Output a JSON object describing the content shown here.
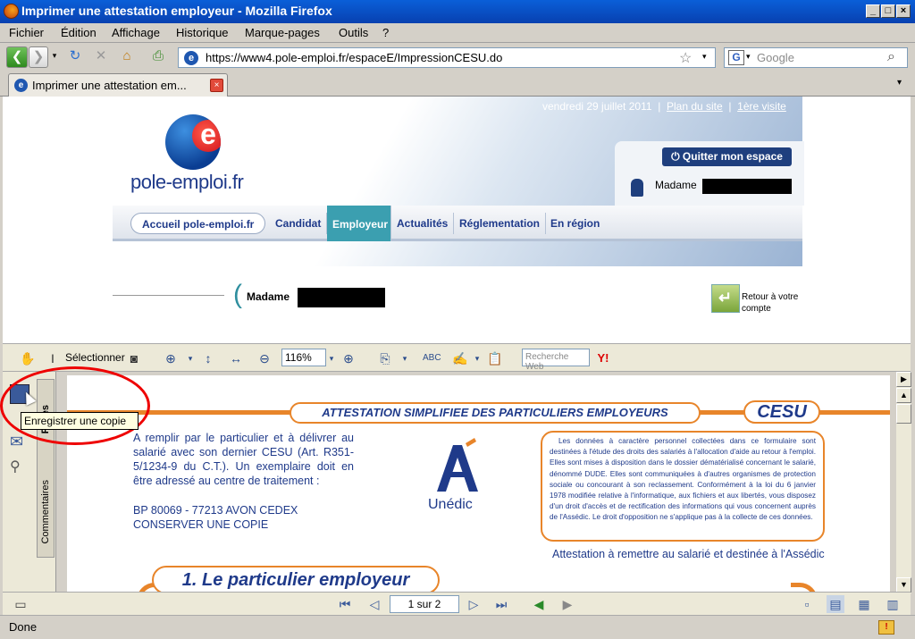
{
  "window": {
    "title": "Imprimer une attestation employeur - Mozilla Firefox"
  },
  "menu": [
    "Fichier",
    "Édition",
    "Affichage",
    "Historique",
    "Marque-pages",
    "Outils",
    "?"
  ],
  "nav": {
    "url": "https://www4.pole-emploi.fr/espaceE/ImpressionCESU.do",
    "search_placeholder": "Google"
  },
  "tab": {
    "label": "Imprimer une attestation em..."
  },
  "site": {
    "logo_text": "pole-emploi.fr",
    "date": "vendredi 29 juillet 2011",
    "sitemap": "Plan du site",
    "first_visit": "1ère visite",
    "quit": "Quitter mon espace",
    "user": "Madame",
    "menu": [
      "Accueil pole-emploi.fr",
      "Candidat",
      "Employeur",
      "Actualités",
      "Réglementation",
      "En région"
    ],
    "user2": "Madame",
    "back": "Retour à votre compte"
  },
  "pdf_toolbar": {
    "select": "Sélectionner",
    "zoom": "116%",
    "search_placeholder": "Recherche Web"
  },
  "sidebar": {
    "tab_pages": "Pages",
    "tab_comments": "Commentaires"
  },
  "tooltip": "Enregistrer une copie",
  "doc": {
    "title": "ATTESTATION SIMPLIFIEE DES PARTICULIERS EMPLOYEURS",
    "cesu": "CESU",
    "instructions": "A remplir par le particulier et à délivrer au salarié avec son dernier CESU (Art. R351-5/1234-9 du C.T.). Un exemplaire doit en être adressé au centre de traitement :",
    "address1": "BP 80069 - 77213 AVON CEDEX",
    "address2": "CONSERVER UNE COPIE",
    "unedic": "Unédic",
    "privacy": "Les données à caractère personnel collectées dans ce formulaire sont destinées à l'étude des droits des salariés à l'allocation d'aide au retour à l'emploi. Elles sont mises à disposition dans le dossier dématérialisé concernant le salarié, dénommé DUDE. Elles sont communiquées à d'autres organismes de protection sociale ou concourant à son reclassement. Conformément à la loi du 6 janvier 1978 modifiée relative à l'informatique, aux fichiers et aux libertés, vous disposez d'un droit d'accès et de rectification des informations qui vous concernent auprès de l'Assédic. Le droit d'opposition ne s'applique pas à la collecte de ces données.",
    "attest": "Attestation à remettre au salarié et destinée à l'Assédic",
    "section1": "1. Le particulier employeur"
  },
  "pdf_nav": {
    "page": "1 sur 2"
  },
  "status": "Done"
}
